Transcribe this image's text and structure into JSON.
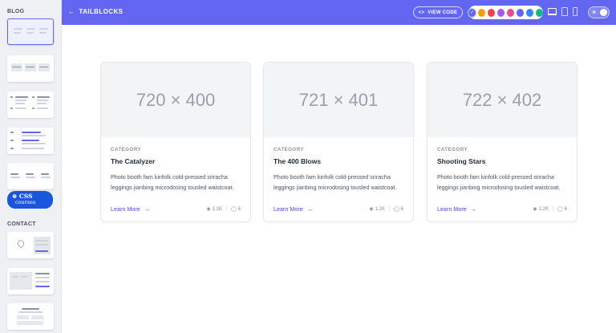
{
  "sidebar": {
    "blog_label": "BLOG",
    "contact_label": "CONTACT",
    "badge": {
      "line1": "CSS",
      "line2": "courses"
    }
  },
  "header": {
    "brand": "TAILBLOCKS",
    "view_code": "VIEW CODE",
    "theme_colors": [
      "#6366f1",
      "#f59e0b",
      "#ef4444",
      "#a855f7",
      "#ec4899",
      "#6366f1",
      "#3b82f6",
      "#10b981"
    ],
    "selected_color": "indigo"
  },
  "cards": [
    {
      "image_text": "720 × 400",
      "category": "CATEGORY",
      "title": "The Catalyzer",
      "description": "Photo booth fam kinfolk cold-pressed sriracha leggings jianbing microdosing tousled waistcoat.",
      "link": "Learn More",
      "views": "1.2K",
      "comments": "6"
    },
    {
      "image_text": "721 × 401",
      "category": "CATEGORY",
      "title": "The 400 Blows",
      "description": "Photo booth fam kinfolk cold-pressed sriracha leggings jianbing microdosing tousled waistcoat.",
      "link": "Learn More",
      "views": "1.2K",
      "comments": "6"
    },
    {
      "image_text": "722 × 402",
      "category": "CATEGORY",
      "title": "Shooting Stars",
      "description": "Photo booth fam kinfolk cold-pressed sriracha leggings jianbing microdosing tousled waistcoat.",
      "link": "Learn More",
      "views": "1.2K",
      "comments": "6"
    }
  ]
}
